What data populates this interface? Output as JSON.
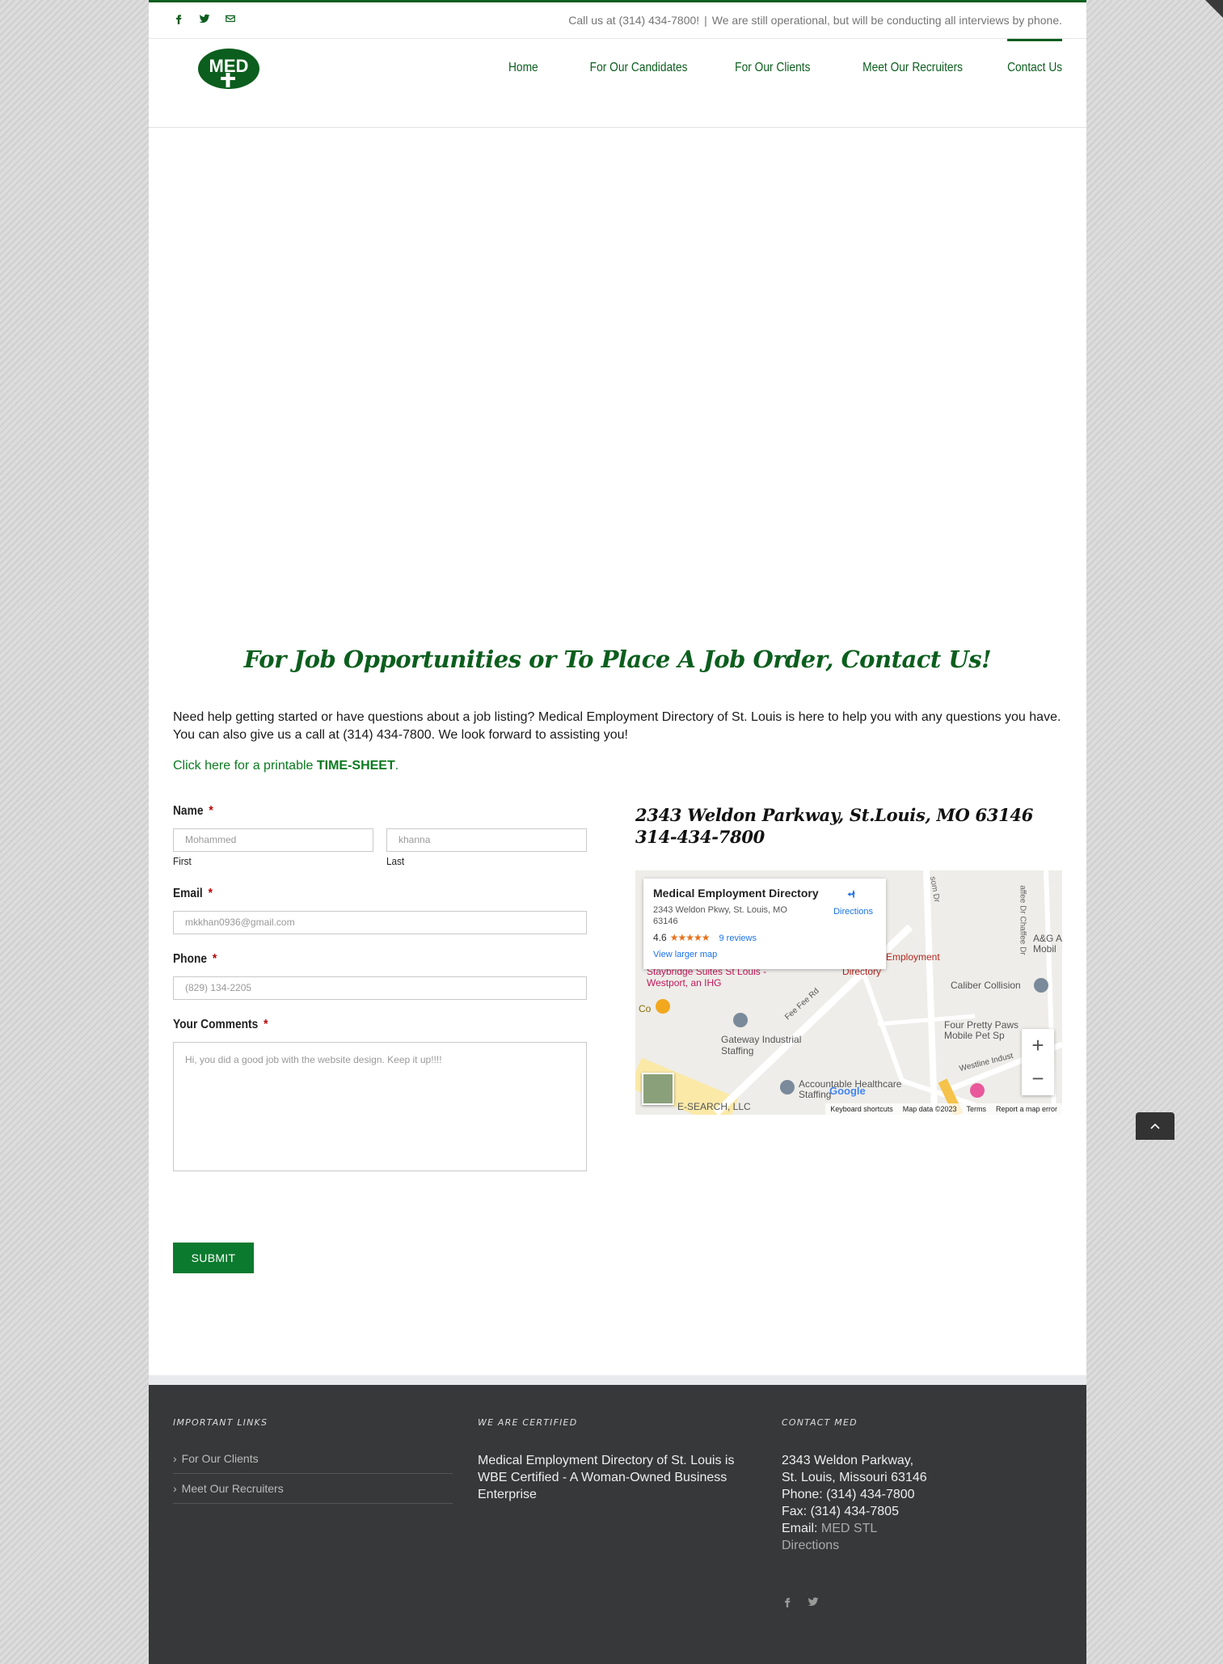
{
  "topbar": {
    "phone_text": "Call us at (314) 434-7800!",
    "separator": "|",
    "notice": "We are still operational, but will be conducting all interviews by phone."
  },
  "logo": {
    "text": "MED"
  },
  "nav": {
    "items": [
      {
        "label": "Home"
      },
      {
        "label": "For Our Candidates"
      },
      {
        "label": "For Our Clients"
      },
      {
        "label": "Meet Our Recruiters"
      },
      {
        "label": "Contact Us"
      }
    ]
  },
  "content": {
    "heading": "For Job Opportunities or To Place A Job Order, Contact Us!",
    "intro": "Need help getting started or have questions about a job listing? Medical Employment Directory of St. Louis is here to help you with any questions you have. You can also give us a call at (314) 434-7800. We look forward to assisting you!",
    "timesheet_prefix": "Click here for a printable ",
    "timesheet_link": "TIME-SHEET",
    "timesheet_suffix": "."
  },
  "form": {
    "name_label": "Name",
    "required_mark": "*",
    "first_value": "Mohammed",
    "first_sublabel": "First",
    "last_value": "khanna",
    "last_sublabel": "Last",
    "email_label": "Email",
    "email_value": "mkkhan0936@gmail.com",
    "phone_label": "Phone",
    "phone_value": "(829) 134-2205",
    "comments_label": "Your Comments",
    "comments_value": "Hi, you did a good job with the website design. Keep it up!!!!",
    "submit_label": "SUBMIT"
  },
  "address": {
    "line1": "2343 Weldon Parkway, St.Louis, MO 63146",
    "line2": "314-434-7800"
  },
  "map": {
    "place_name": "Medical Employment Directory",
    "place_address": "2343 Weldon Pkwy, St. Louis, MO 63146",
    "rating": "4.6",
    "stars": "★★★★★",
    "reviews": "9 reviews",
    "larger_map": "View larger map",
    "directions": "Directions",
    "labels": {
      "employment": "Employment",
      "staybridge": "Staybridge Suites St Louis - Westport, an IHG",
      "caliber": "Caliber Collision",
      "fourpretty": "Four Pretty Paws Mobile Pet Sp",
      "gateway": "Gateway Industrial Staffing",
      "accountable": "Accountable Healthcare Staffing",
      "esearch": "E-SEARCH, LLC",
      "feefee": "Fee Fee Rd",
      "westline": "Westline Indust",
      "ag": "A&G A Mobil",
      "chaffee": "affee Dr Chaffee Dr",
      "som": "som Dr",
      "co": "Co",
      "directory": "Directory"
    },
    "zoom_in": "+",
    "zoom_out": "−",
    "footer": {
      "shortcuts": "Keyboard shortcuts",
      "data": "Map data ©2023",
      "terms": "Terms",
      "report": "Report a map error"
    },
    "google": "Google"
  },
  "footer": {
    "links_heading": "Important Links",
    "links": [
      {
        "label": "For Our Clients"
      },
      {
        "label": "Meet Our Recruiters"
      }
    ],
    "certified_heading": "We Are Certified",
    "certified_text": "Medical Employment Directory of St. Louis is WBE Certified - A Woman-Owned Business Enterprise",
    "contact_heading": "Contact MED",
    "contact": {
      "line1": "2343 Weldon Parkway,",
      "line2": "St. Louis, Missouri 63146",
      "phone": "Phone: (314) 434-7800",
      "fax": "Fax: (314) 434-7805",
      "email_label": "Email: ",
      "email_link": "MED STL",
      "directions": "Directions"
    }
  },
  "colors": {
    "brand_green": "#0b5e1d",
    "footer_bg": "#363839"
  }
}
